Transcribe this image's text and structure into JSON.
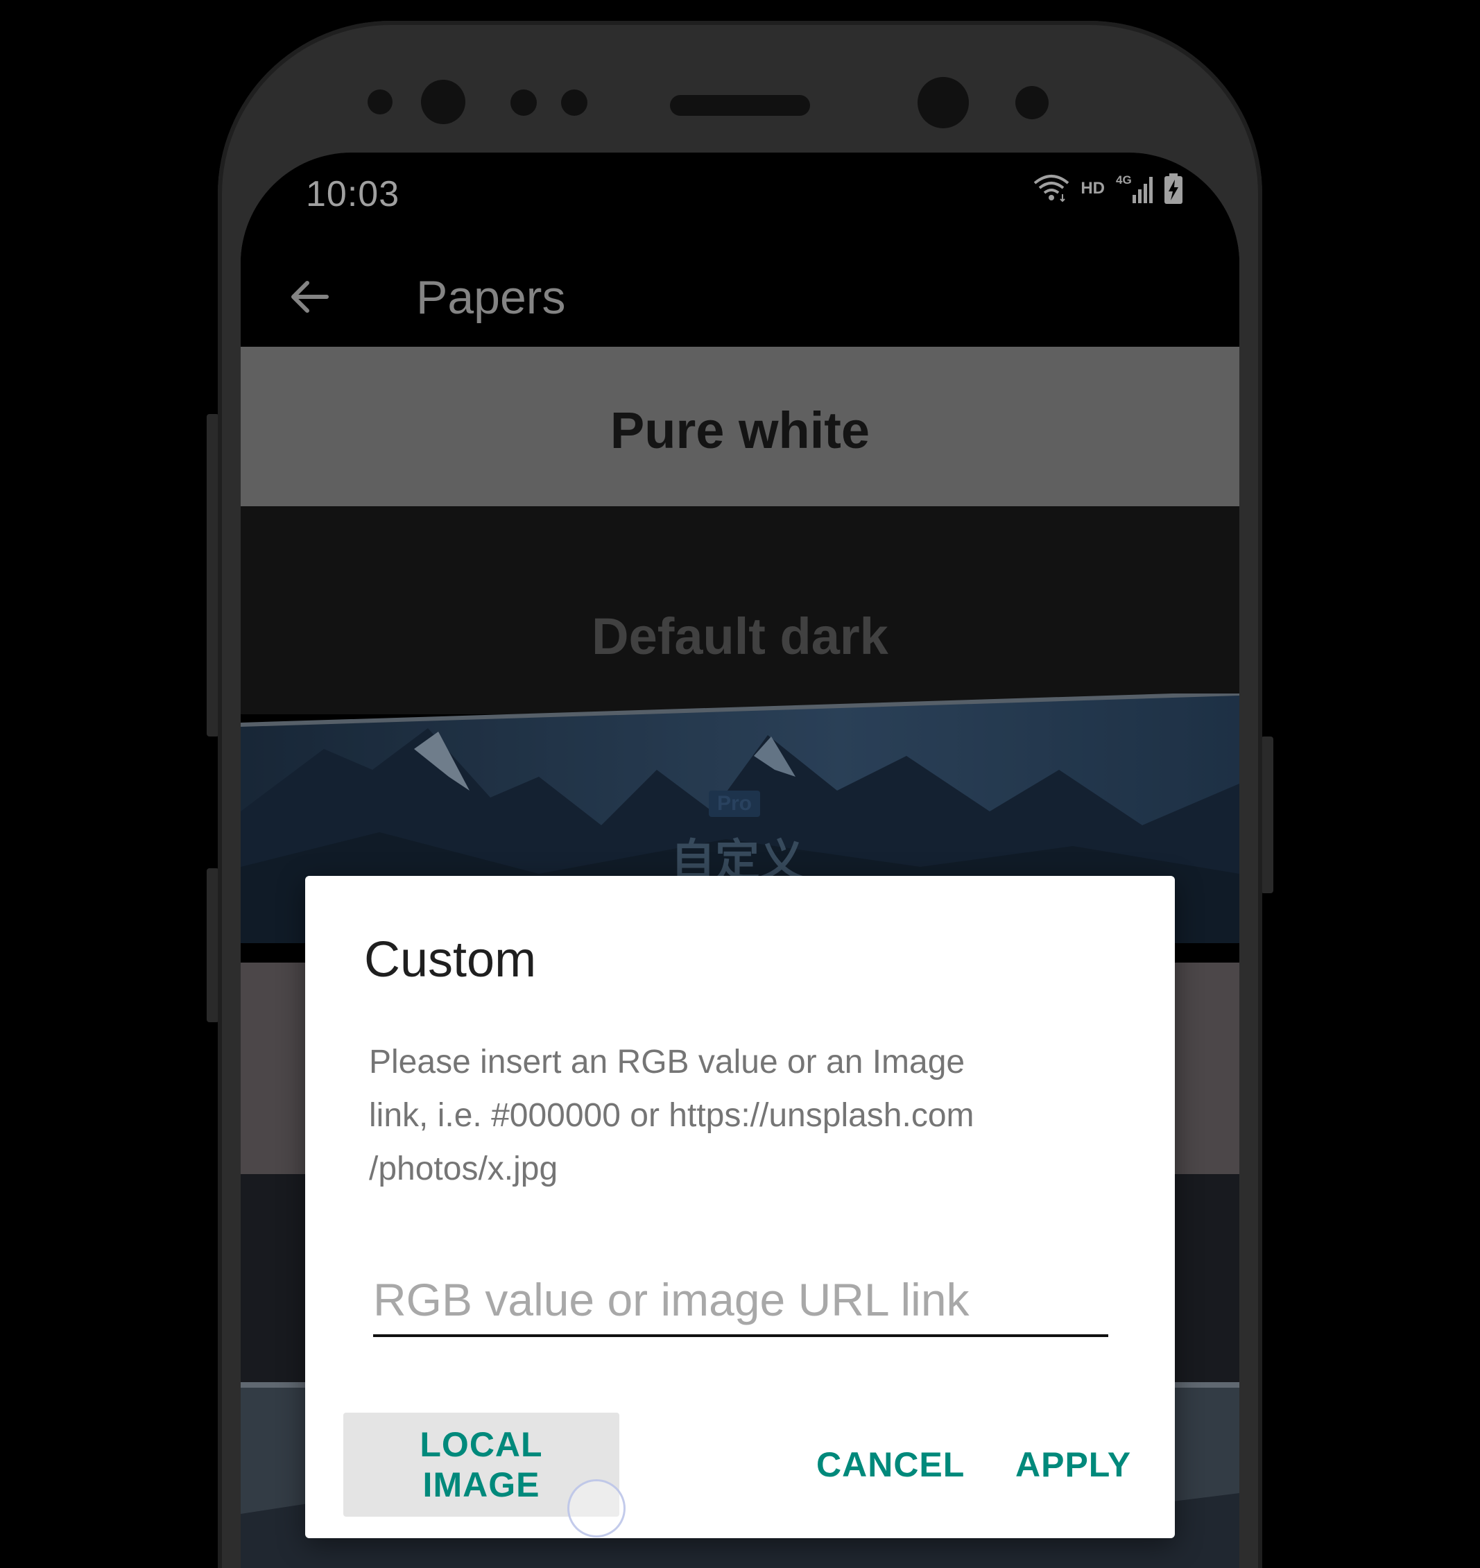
{
  "status_bar": {
    "time": "10:03",
    "network_label": "HD",
    "network_type": "4G",
    "icons": [
      "wifi-icon",
      "signal-icon",
      "battery-charging-icon"
    ]
  },
  "app_bar": {
    "title": "Papers",
    "back_icon": "arrow-back-icon"
  },
  "papers": [
    {
      "label": "Pure white"
    },
    {
      "label": "Default dark"
    },
    {
      "label": "自定义",
      "badge": "Pro"
    }
  ],
  "dialog": {
    "title": "Custom",
    "message": "Please insert an RGB value or an Image\nlink, i.e. #000000 or https://unsplash.com\n/photos/x.jpg",
    "input": {
      "value": "",
      "placeholder": "RGB value or image URL link"
    },
    "buttons": {
      "local_image": "LOCAL IMAGE",
      "cancel": "CANCEL",
      "apply": "APPLY"
    }
  },
  "colors": {
    "accent": "#00897b",
    "dialog_background": "#ffffff",
    "screen_background": "#000000"
  }
}
